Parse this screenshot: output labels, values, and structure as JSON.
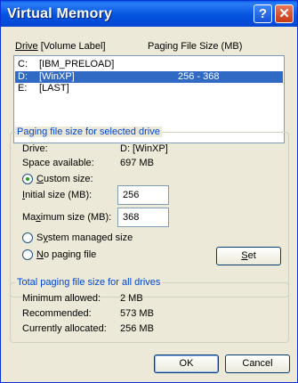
{
  "window": {
    "title": "Virtual Memory"
  },
  "list": {
    "header_drive": "Drive",
    "header_drive_rest": "[Volume Label]",
    "header_paging": "Paging File Size (MB)",
    "rows": [
      {
        "drive": "C:",
        "label": "[IBM_PRELOAD]",
        "size": ""
      },
      {
        "drive": "D:",
        "label": "[WinXP]",
        "size": "256 - 368"
      },
      {
        "drive": "E:",
        "label": "[LAST]",
        "size": ""
      }
    ]
  },
  "selected_group": {
    "title": "Paging file size for selected drive",
    "drive_label": "Drive:",
    "drive_value": "D:  [WinXP]",
    "space_label": "Space available:",
    "space_value": "697 MB",
    "custom_first": "C",
    "custom_rest": "ustom size:",
    "initial_first": "I",
    "initial_rest": "nitial size (MB):",
    "initial_value": "256",
    "maximum_pre": "Ma",
    "maximum_u": "x",
    "maximum_rest": "imum size (MB):",
    "maximum_value": "368",
    "system_pre": "S",
    "system_u": "y",
    "system_rest": "stem managed size",
    "nopaging_pre": "N",
    "nopaging_rest": "o paging file",
    "set_u": "S",
    "set_rest": "et"
  },
  "total_group": {
    "title": "Total paging file size for all drives",
    "min_label": "Minimum allowed:",
    "min_value": "2 MB",
    "rec_label": "Recommended:",
    "rec_value": "573 MB",
    "cur_label": "Currently allocated:",
    "cur_value": "256 MB"
  },
  "buttons": {
    "ok": "OK",
    "cancel": "Cancel"
  }
}
